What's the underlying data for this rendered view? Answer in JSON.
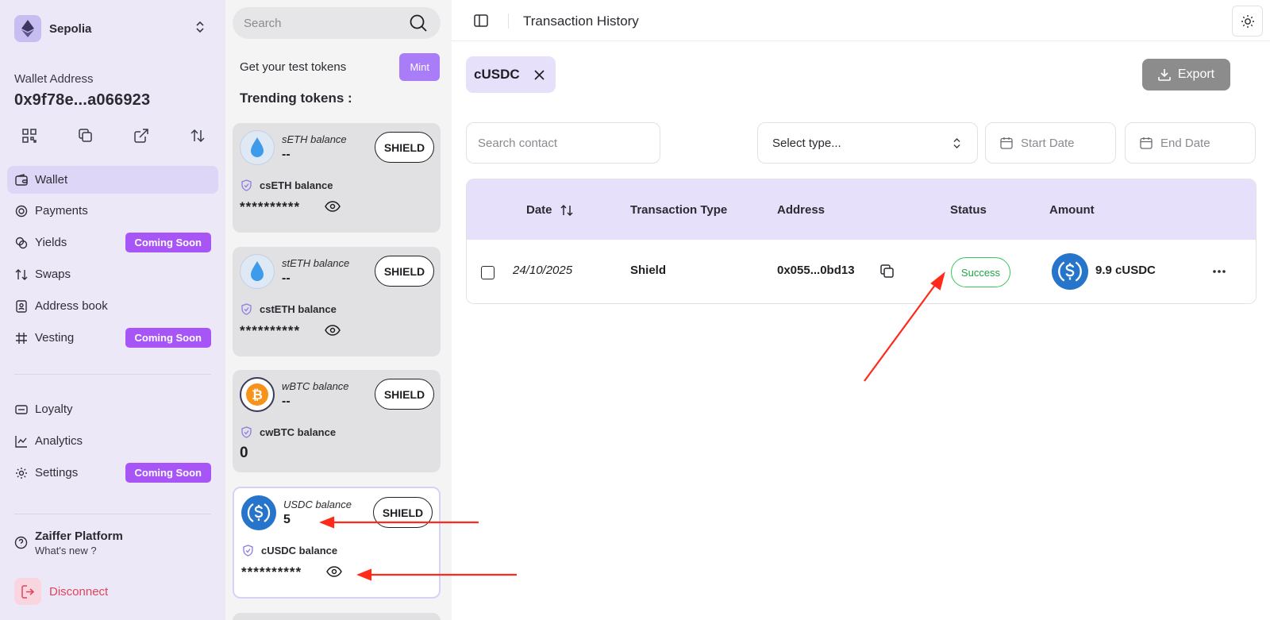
{
  "network": {
    "name": "Sepolia"
  },
  "wallet": {
    "label": "Wallet Address",
    "address": "0x9f78e...a066923"
  },
  "nav": {
    "wallet": "Wallet",
    "payments": "Payments",
    "yields": "Yields",
    "swaps": "Swaps",
    "address_book": "Address book",
    "vesting": "Vesting",
    "loyalty": "Loyalty",
    "analytics": "Analytics",
    "settings": "Settings",
    "coming_soon": "Coming Soon"
  },
  "footer": {
    "platform_title": "Zaiffer Platform",
    "platform_sub": "What's new ?",
    "disconnect": "Disconnect"
  },
  "tokens_panel": {
    "search_placeholder": "Search",
    "test_tokens_label": "Get your test tokens",
    "mint_label": "Mint",
    "trending_label": "Trending tokens :",
    "shield_label": "SHIELD",
    "cards": [
      {
        "balance_label": "sETH balance",
        "balance": "--",
        "confidential_label": "csETH balance",
        "confidential_value": "**********"
      },
      {
        "balance_label": "stETH balance",
        "balance": "--",
        "confidential_label": "cstETH balance",
        "confidential_value": "**********"
      },
      {
        "balance_label": "wBTC balance",
        "balance": "--",
        "confidential_label": "cwBTC balance",
        "confidential_value": "0"
      },
      {
        "balance_label": "USDC balance",
        "balance": "5",
        "confidential_label": "cUSDC balance",
        "confidential_value": "**********"
      }
    ]
  },
  "main": {
    "title": "Transaction History",
    "filter_chip": "cUSDC",
    "export_label": "Export",
    "search_contact_placeholder": "Search contact",
    "select_type": "Select type...",
    "start_date": "Start Date",
    "end_date": "End Date",
    "columns": {
      "date": "Date",
      "type": "Transaction Type",
      "address": "Address",
      "status": "Status",
      "amount": "Amount"
    },
    "rows": [
      {
        "date": "24/10/2025",
        "type": "Shield",
        "address": "0x055...0bd13",
        "status": "Success",
        "amount": "9.9 cUSDC"
      }
    ]
  },
  "colors": {
    "accent": "#a855f7",
    "sidebar_bg": "#ece8f8",
    "success": "#22a447",
    "usdc": "#2775ca",
    "annotation": "#ff2a1a"
  }
}
